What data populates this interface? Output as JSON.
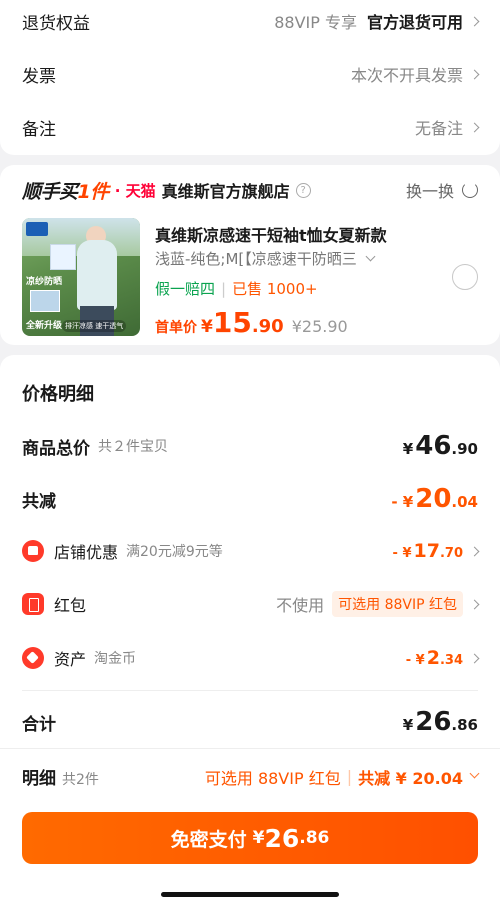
{
  "top": {
    "returns": {
      "label": "退货权益",
      "tag": "88VIP 专享",
      "value": "官方退货可用"
    },
    "invoice": {
      "label": "发票",
      "value": "本次不开具发票"
    },
    "note": {
      "label": "备注",
      "value": "无备注"
    }
  },
  "product": {
    "store_prefix": "顺手买",
    "store_prefix_hl": "1件",
    "platform": "· 天猫",
    "store_name": "真维斯官方旗舰店",
    "swap_label": "换一换",
    "title": "真维斯凉感速干短袖t恤女夏新款",
    "spec": "浅蓝-纯色;M[【凉感速干防晒三",
    "tag_guarantee": "假一赔四",
    "sold": "已售 1000+",
    "first_price_label": "首单价",
    "price_yen": "¥",
    "price_int": "15",
    "price_dec": ".90",
    "original_price": "¥25.90",
    "thumb_text_1": "凉纱防晒",
    "thumb_text_2": "全新升级",
    "thumb_text_3": "排汗凉感 速干透气"
  },
  "price_detail": {
    "title": "价格明细",
    "goods_total": {
      "label": "商品总价",
      "sub": "共２件宝贝",
      "yen": "¥",
      "int": "46",
      "dec": ".90"
    },
    "reduction": {
      "label": "共减",
      "yen": "- ¥",
      "int": "20",
      "dec": ".04"
    },
    "store_discount": {
      "label": "店铺优惠",
      "sub": "满20元减9元等",
      "yen": "- ¥",
      "int": "17",
      "dec": ".70"
    },
    "red_packet": {
      "label": "红包",
      "value": "不使用",
      "tag": "可选用 88VIP 红包"
    },
    "assets": {
      "label": "资产",
      "sub": "淘金币",
      "yen": "- ¥",
      "int": "2",
      "dec": ".34"
    },
    "total": {
      "label": "合计",
      "yen": "¥",
      "int": "26",
      "dec": ".86"
    }
  },
  "bottom": {
    "detail_label": "明细",
    "count": "共2件",
    "vip_hint": "可选用 88VIP 红包",
    "reduce": "共减 ¥ 20.04",
    "pay_label": "免密支付",
    "pay_yen": "¥",
    "pay_int": "26",
    "pay_dec": ".86"
  }
}
